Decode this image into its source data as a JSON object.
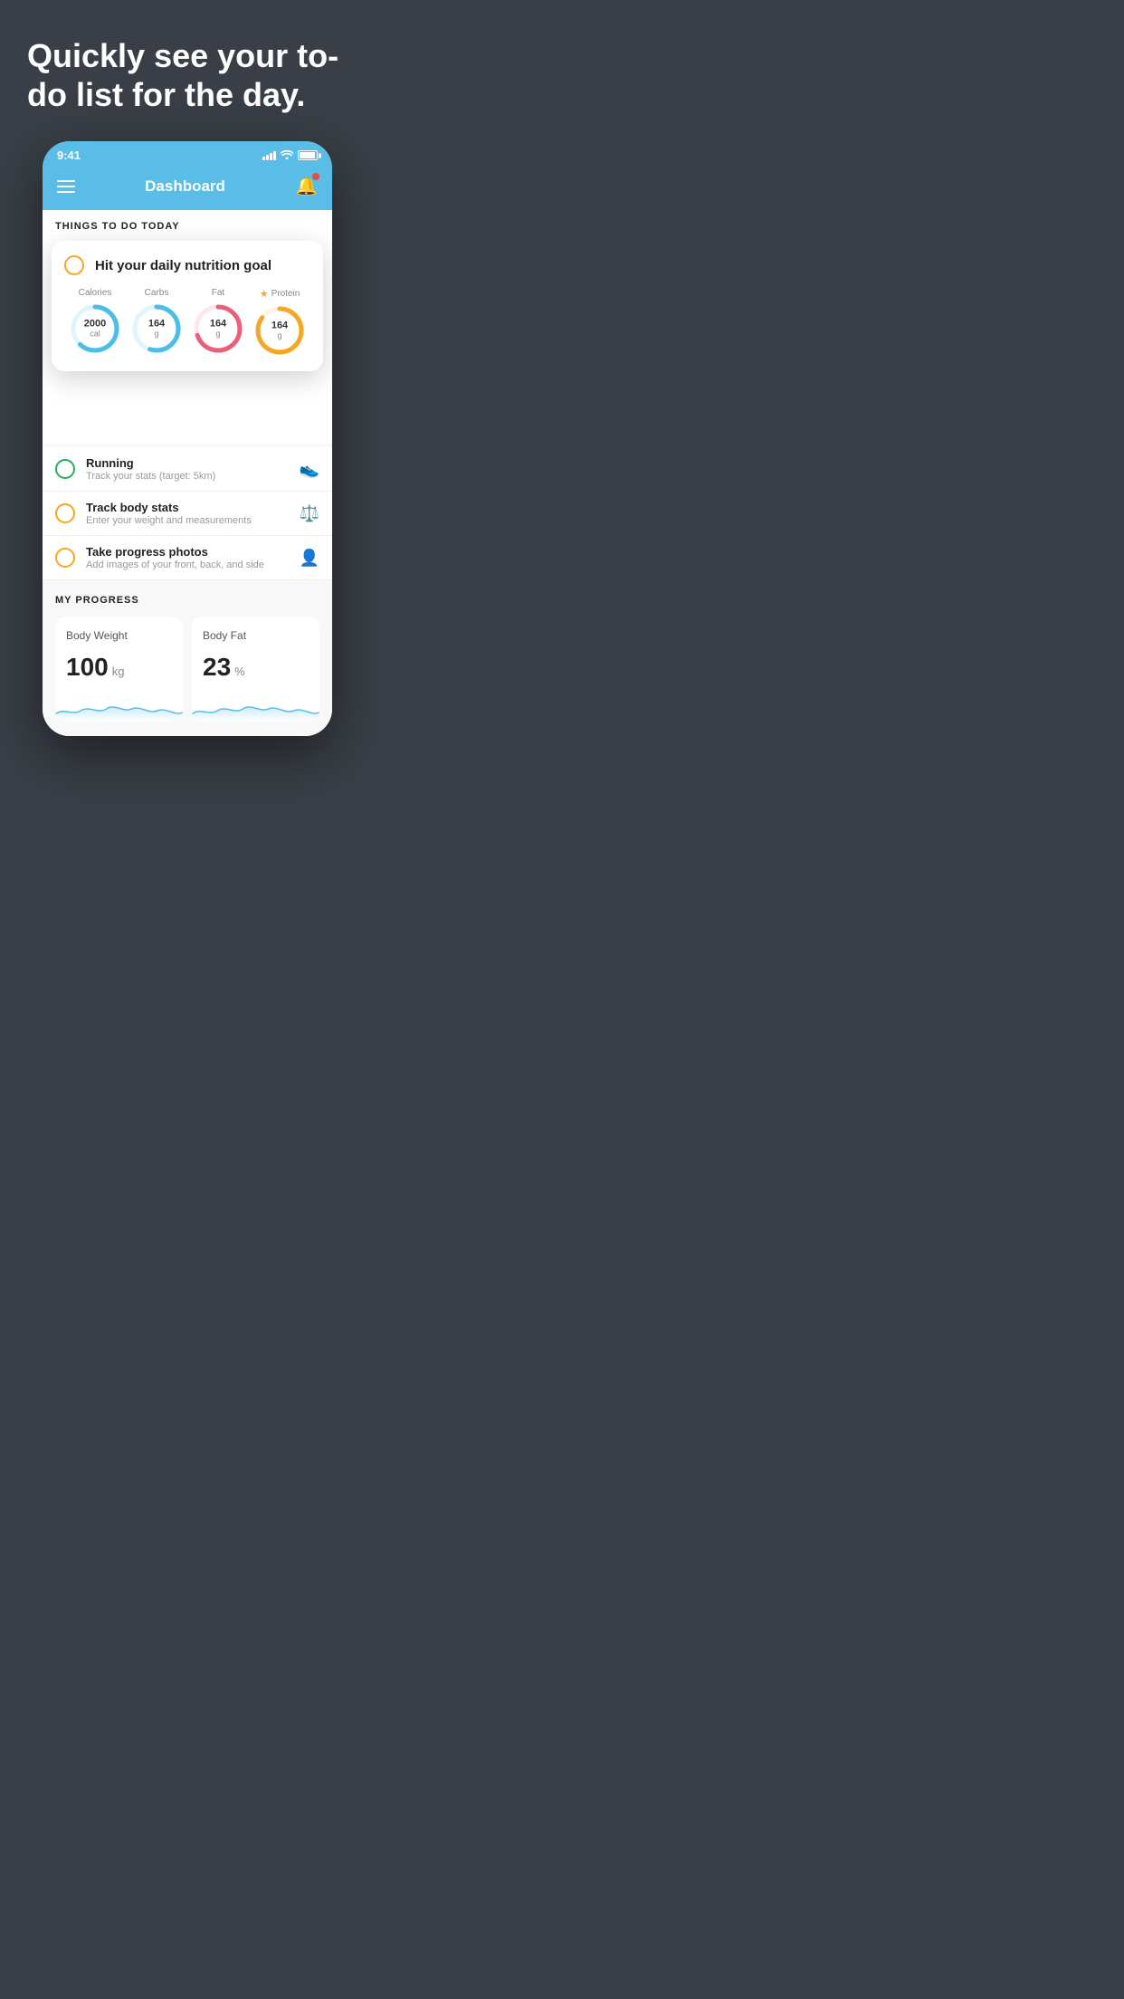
{
  "page": {
    "background_color": "#3a3f47"
  },
  "hero": {
    "headline": "Quickly see your to-do list for the day."
  },
  "status_bar": {
    "time": "9:41"
  },
  "app_header": {
    "title": "Dashboard"
  },
  "things_to_do": {
    "section_label": "THINGS TO DO TODAY",
    "featured_task": {
      "label": "Hit your daily nutrition goal",
      "check_state": "unchecked"
    },
    "nutrition": {
      "items": [
        {
          "label": "Calories",
          "value": "2000",
          "unit": "cal",
          "color": "#4bbde8",
          "track_color": "#e0f4fd",
          "percent": 62,
          "starred": false
        },
        {
          "label": "Carbs",
          "value": "164",
          "unit": "g",
          "color": "#4bbde8",
          "track_color": "#e0f4fd",
          "percent": 55,
          "starred": false
        },
        {
          "label": "Fat",
          "value": "164",
          "unit": "g",
          "color": "#e8607a",
          "track_color": "#fce8ec",
          "percent": 70,
          "starred": false
        },
        {
          "label": "Protein",
          "value": "164",
          "unit": "g",
          "color": "#f5a623",
          "track_color": "#fef3e0",
          "percent": 85,
          "starred": true
        }
      ]
    },
    "todo_items": [
      {
        "title": "Running",
        "subtitle": "Track your stats (target: 5km)",
        "check_color": "#27ae60",
        "icon": "👟"
      },
      {
        "title": "Track body stats",
        "subtitle": "Enter your weight and measurements",
        "check_color": "#f5a623",
        "icon": "⚖️"
      },
      {
        "title": "Take progress photos",
        "subtitle": "Add images of your front, back, and side",
        "check_color": "#f5a623",
        "icon": "👤"
      }
    ]
  },
  "progress": {
    "section_label": "MY PROGRESS",
    "cards": [
      {
        "title": "Body Weight",
        "value": "100",
        "unit": "kg"
      },
      {
        "title": "Body Fat",
        "value": "23",
        "unit": "%"
      }
    ]
  }
}
